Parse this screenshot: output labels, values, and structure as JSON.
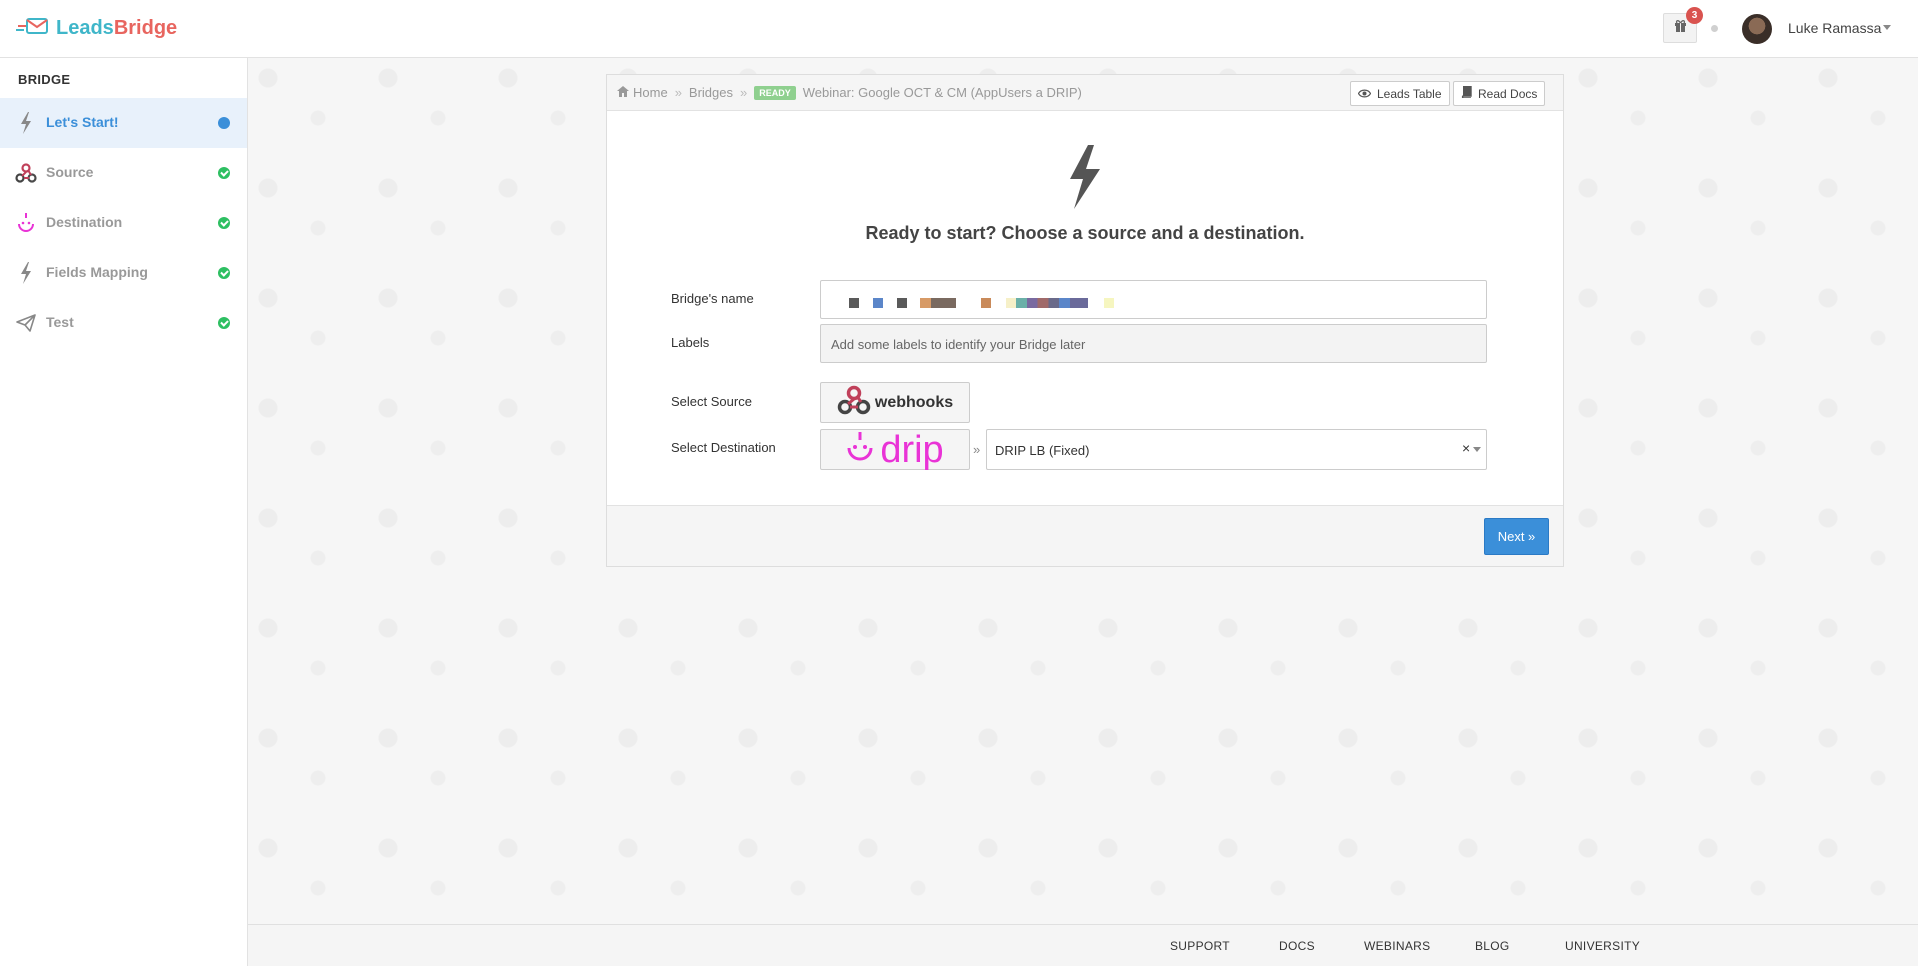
{
  "app": {
    "logo_leads": "Leads",
    "logo_bridge": "Bridge"
  },
  "topbar": {
    "notification_count": "3",
    "user_name": "Luke Ramassa"
  },
  "sidebar": {
    "title": "BRIDGE",
    "items": [
      {
        "label": "Let's Start!",
        "icon": "bolt-icon",
        "status": "current"
      },
      {
        "label": "Source",
        "icon": "webhooks-icon",
        "status": "done"
      },
      {
        "label": "Destination",
        "icon": "drip-icon",
        "status": "done"
      },
      {
        "label": "Fields Mapping",
        "icon": "bolt-icon",
        "status": "done"
      },
      {
        "label": "Test",
        "icon": "paper-plane-icon",
        "status": "done"
      }
    ]
  },
  "breadcrumb": {
    "home": "Home",
    "bridges": "Bridges",
    "status_badge": "READY",
    "current": "Webinar: Google OCT & CM (AppUsers a DRIP)"
  },
  "header_buttons": {
    "leads_table": "Leads Table",
    "read_docs": "Read Docs"
  },
  "hero": {
    "text": "Ready to start? Choose a source and a destination."
  },
  "form": {
    "name_label": "Bridge's name",
    "labels_label": "Labels",
    "labels_placeholder": "Add some labels to identify your Bridge later",
    "source_label": "Select Source",
    "source_name": "webhooks",
    "destination_label": "Select Destination",
    "destination_name": "drip",
    "destination_account": "DRIP LB (Fixed)",
    "clear_symbol": "×",
    "arrow_symbol": "»"
  },
  "actions": {
    "next": "Next »"
  },
  "footer": {
    "links": [
      "SUPPORT",
      "DOCS",
      "WEBINARS",
      "BLOG",
      "UNIVERSITY"
    ]
  },
  "colors": {
    "accent": "#3b8fd9",
    "success": "#2ebf62",
    "drip": "#e933d6",
    "badge": "#d9534f"
  }
}
